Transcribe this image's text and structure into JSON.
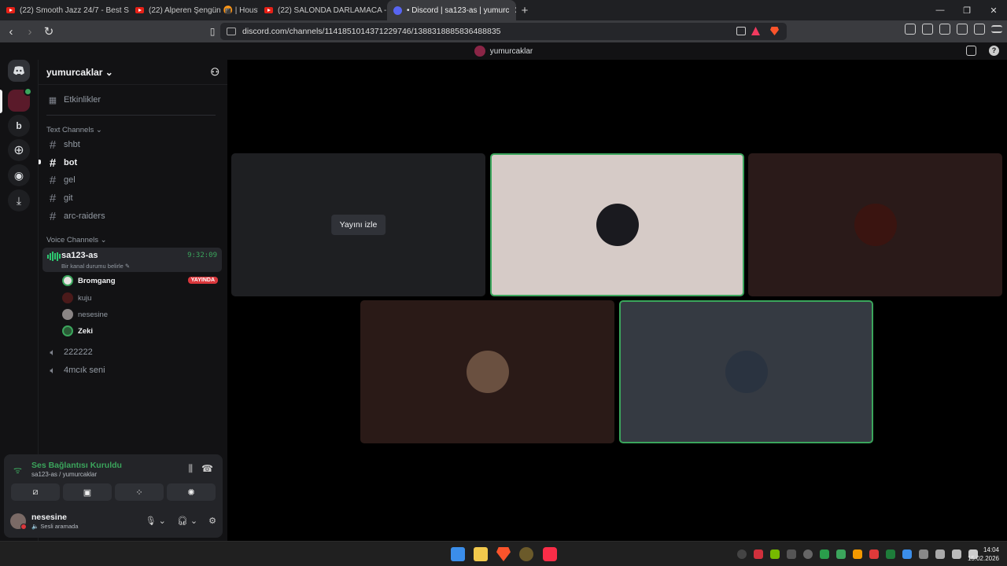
{
  "browser": {
    "tabs": [
      {
        "label": "(22) Smooth Jazz 24/7 - Best Smooth",
        "active": false
      },
      {
        "label": "(22) Alperen Şengün 🍘 | Houston R",
        "active": false
      },
      {
        "label": "(22) SALONDA DARLAMACA - YouTu",
        "active": false
      },
      {
        "label": "• Discord | sa123-as | yumurc",
        "active": true
      }
    ],
    "new_tab": "+",
    "url": "discord.com/channels/1141851014371229746/1388318885836488835"
  },
  "discord": {
    "top_title": "yumurcaklar",
    "guild_b": "b",
    "server_name": "yumurcaklar ⌄",
    "events_label": "Etkinlikler",
    "text_category": "Text Channels ⌄",
    "text_channels": [
      "shbt",
      "bot",
      "gel",
      "git",
      "arc-raiders"
    ],
    "voice_category": "Voice Channels ⌄",
    "active_voice": {
      "name": "sa123-as",
      "timer": "9:32:09",
      "status": "Bir kanal durumu belirle ✎"
    },
    "voice_users": [
      {
        "name": "Bromgang",
        "live": "YAYINDA",
        "bold": true,
        "color": "#e6e2e0"
      },
      {
        "name": "kuju",
        "bold": false,
        "color": "#4a1a1a"
      },
      {
        "name": "nesesine",
        "bold": false,
        "color": "#8a8585"
      },
      {
        "name": "Zeki",
        "bold": true,
        "color": "#2a5a36"
      }
    ],
    "other_voice": [
      "222222",
      "4mcık seni"
    ],
    "panel": {
      "connection": "Ses Bağlantısı Kuruldu",
      "path": "sa123-as / yumurcaklar",
      "username": "nesesine",
      "user_status": "🔈 Sesli aramada"
    },
    "stage": {
      "watch_label": "Yayını izle",
      "tiles": [
        {
          "bg": "#1e1f22",
          "speaking": false,
          "avatar": ""
        },
        {
          "bg": "#d6cbc7",
          "speaking": true,
          "avatar": "#1a1a1f"
        },
        {
          "bg": "#2a1a19",
          "speaking": false,
          "avatar": "#3a1410"
        },
        {
          "bg": "#2a1a17",
          "speaking": false,
          "avatar": "#6a5040"
        },
        {
          "bg": "#353a42",
          "speaking": true,
          "avatar": "#2a3340"
        }
      ]
    }
  },
  "taskbar": {
    "time": "14:04",
    "date": "15.02.2026"
  },
  "colors": {
    "accent_green": "#3ba55c",
    "live_red": "#da373c",
    "blurple": "#5865f2"
  }
}
